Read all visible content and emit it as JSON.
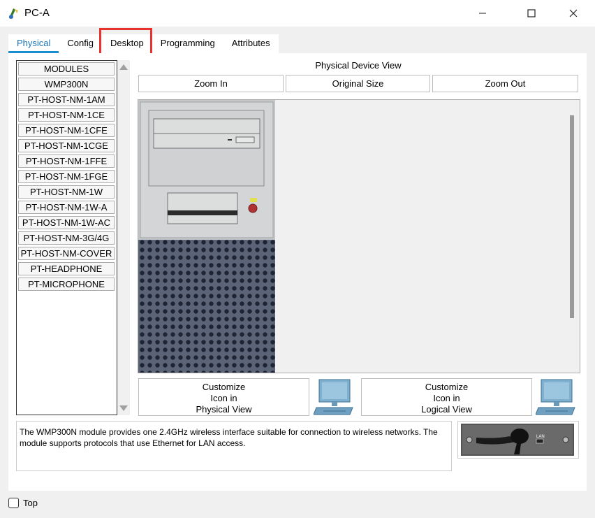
{
  "window": {
    "title": "PC-A",
    "minimize_icon": "minimize-icon",
    "maximize_icon": "maximize-icon",
    "close_icon": "close-icon"
  },
  "tabs": [
    {
      "label": "Physical",
      "active": true
    },
    {
      "label": "Config",
      "active": false
    },
    {
      "label": "Desktop",
      "active": false,
      "highlighted": true
    },
    {
      "label": "Programming",
      "active": false
    },
    {
      "label": "Attributes",
      "active": false
    }
  ],
  "modules": [
    "MODULES",
    "WMP300N",
    "PT-HOST-NM-1AM",
    "PT-HOST-NM-1CE",
    "PT-HOST-NM-1CFE",
    "PT-HOST-NM-1CGE",
    "PT-HOST-NM-1FFE",
    "PT-HOST-NM-1FGE",
    "PT-HOST-NM-1W",
    "PT-HOST-NM-1W-A",
    "PT-HOST-NM-1W-AC",
    "PT-HOST-NM-3G/4G",
    "PT-HOST-NM-COVER",
    "PT-HEADPHONE",
    "PT-MICROPHONE"
  ],
  "physical_view": {
    "title": "Physical Device View",
    "zoom_in": "Zoom In",
    "original_size": "Original Size",
    "zoom_out": "Zoom Out"
  },
  "customize": {
    "physical": {
      "line1": "Customize",
      "line2": "Icon in",
      "line3": "Physical View"
    },
    "logical": {
      "line1": "Customize",
      "line2": "Icon in",
      "line3": "Logical View"
    }
  },
  "description": "The WMP300N module provides one 2.4GHz wireless interface suitable for connection to wireless networks. The module supports protocols that use Ethernet for LAN access.",
  "module_image": {
    "port_label": "LAN"
  },
  "footer": {
    "top_label": "Top",
    "top_checked": false
  },
  "colors": {
    "accent": "#1a8fd0",
    "highlight": "#e8322d"
  }
}
